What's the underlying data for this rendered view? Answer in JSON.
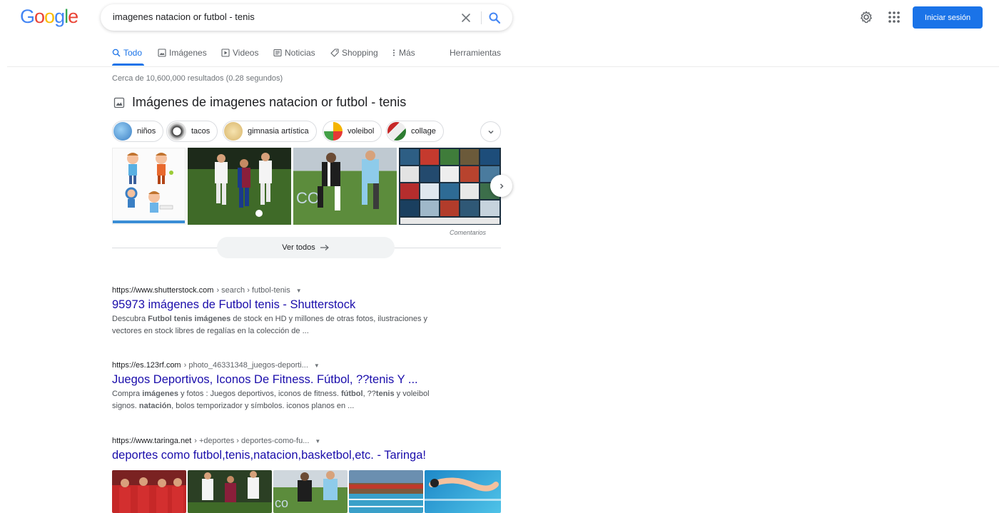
{
  "header": {
    "logo_letters": [
      "G",
      "o",
      "o",
      "g",
      "l",
      "e"
    ],
    "logo_colors": [
      "#4285f4",
      "#ea4335",
      "#fbbc05",
      "#4285f4",
      "#34a853",
      "#ea4335"
    ],
    "search_value": "imagenes natacion or futbol - tenis",
    "signin_label": "Iniciar sesión"
  },
  "tabs": [
    {
      "label": "Todo",
      "icon": "search-icon",
      "active": true
    },
    {
      "label": "Imágenes",
      "icon": "image-icon"
    },
    {
      "label": "Videos",
      "icon": "video-icon"
    },
    {
      "label": "Noticias",
      "icon": "news-icon"
    },
    {
      "label": "Shopping",
      "icon": "tag-icon"
    },
    {
      "label": "Más",
      "icon": "more-vert-icon"
    }
  ],
  "tools_label": "Herramientas",
  "stats": "Cerca de 10,600,000 resultados (0.28 segundos)",
  "images_block": {
    "heading": "Imágenes de imagenes natacion or futbol - tenis",
    "chips": [
      "niños",
      "tacos",
      "gimnasia artística",
      "voleibol",
      "collage"
    ],
    "feedback_label": "Comentarios",
    "see_all_label": "Ver todos"
  },
  "results": [
    {
      "site": "https://www.shutterstock.com",
      "path": " › search › futbol-tenis",
      "title": "95973 imágenes de Futbol tenis - Shutterstock",
      "snippet_parts": [
        {
          "t": "Descubra ",
          "b": false
        },
        {
          "t": "Futbol tenis imágenes",
          "b": true
        },
        {
          "t": " de stock en HD y millones de otras fotos, ilustraciones y vectores en stock libres de regalías en la colección de ...",
          "b": false
        }
      ]
    },
    {
      "site": "https://es.123rf.com",
      "path": " › photo_46331348_juegos-deporti...",
      "title": "Juegos Deportivos, Iconos De Fitness. Fútbol, ??tenis Y ...",
      "snippet_parts": [
        {
          "t": "Compra ",
          "b": false
        },
        {
          "t": "imágenes",
          "b": true
        },
        {
          "t": " y fotos : Juegos deportivos, iconos de fitness. ",
          "b": false
        },
        {
          "t": "fútbol",
          "b": true
        },
        {
          "t": ", ??",
          "b": false
        },
        {
          "t": "tenis",
          "b": true
        },
        {
          "t": " y voleibol signos. ",
          "b": false
        },
        {
          "t": "natación",
          "b": true
        },
        {
          "t": ", bolos temporizador y símbolos. iconos planos en ...",
          "b": false
        }
      ]
    },
    {
      "site": "https://www.taringa.net",
      "path": " › +deportes › deportes-como-fu...",
      "title": "deportes como futbol,tenis,natacion,basketbol,etc. - Taringa!",
      "snippet_parts": []
    }
  ],
  "colors": {
    "accent": "#1a73e8",
    "link": "#1a0dab"
  }
}
